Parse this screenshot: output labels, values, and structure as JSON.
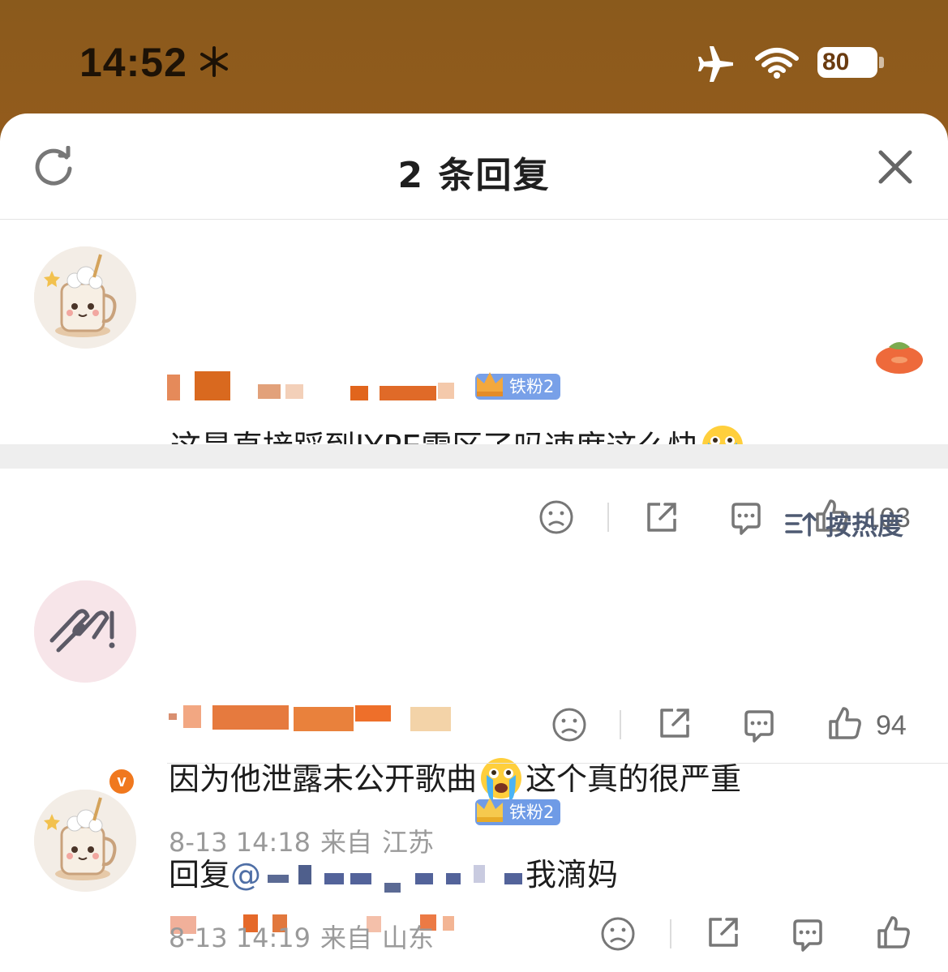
{
  "status_bar": {
    "time": "14:52",
    "battery": "80"
  },
  "sheet": {
    "title": "2 条回复"
  },
  "root_comment": {
    "badge": "铁粉2",
    "text": "这是直接踩到JYPE雷区了吗速度这么快",
    "likes": "103"
  },
  "sort": {
    "label": "按热度"
  },
  "replies": [
    {
      "text_before_emoji": "因为他泄露未公开歌曲",
      "text_after_emoji": "这个真的很严重",
      "date": "8-13 14:18",
      "from": "来自",
      "location": "江苏",
      "likes": "94",
      "verified_badge": "v"
    },
    {
      "badge": "铁粉2",
      "reply_prefix": "回复",
      "mention": "@",
      "text": "我滴妈",
      "date": "8-13 14:19",
      "from": "来自",
      "location": "山东"
    }
  ],
  "icons": {
    "refresh": "refresh-icon",
    "close": "close-icon",
    "dislike": "sad-face-icon",
    "share": "share-icon",
    "comment": "comment-icon",
    "like": "thumbs-up-icon"
  }
}
